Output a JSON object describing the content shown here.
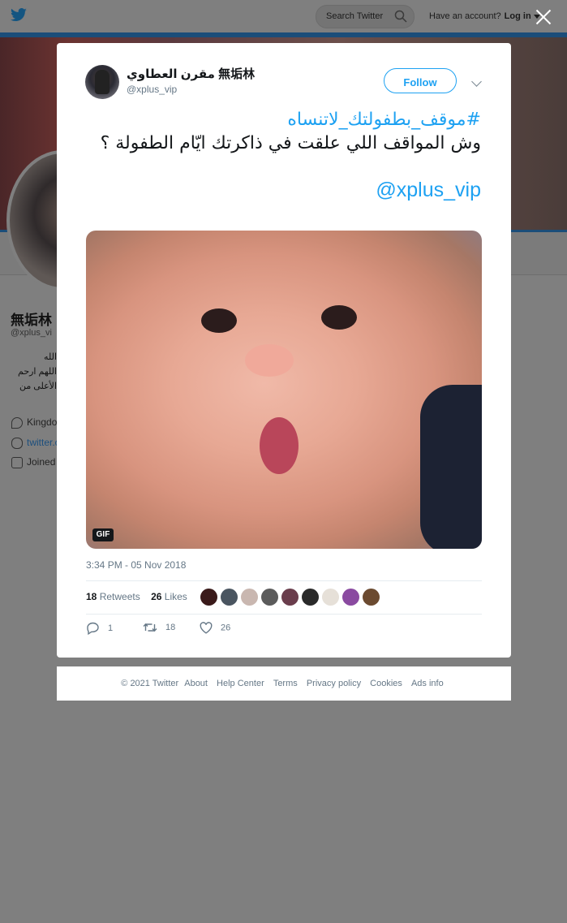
{
  "topbar": {
    "search_placeholder": "Search Twitter",
    "account_prompt": "Have an account?",
    "login_label": "Log in"
  },
  "background_profile": {
    "name": "無垢林",
    "handle": "@xplus_vi",
    "bio_lines": [
      "الله",
      "اللهم ارحم",
      "الأعلى من"
    ],
    "location": "Kingdo",
    "link": "twitter.c",
    "joined": "Joined"
  },
  "tweet": {
    "author_name": "مقرن العطاوي 無垢林",
    "author_handle": "@xplus_vip",
    "follow_label": "Follow",
    "hashtag": "#موقف_بطفولتك_لاتنساه",
    "text": "وش المواقف اللي علقت في ذاكرتك ايّام الطفولة ؟",
    "mention": "@xplus_vip",
    "media_badge": "GIF",
    "timestamp": "3:34 PM - 05 Nov 2018",
    "retweets_count": "18",
    "retweets_label": "Retweets",
    "likes_count": "26",
    "likes_label": "Likes",
    "liker_avatar_colors": [
      "#3a1a1a",
      "#4a5560",
      "#c9b7b0",
      "#5b5b5b",
      "#6a3d4c",
      "#2a2a2a",
      "#e6e0d8",
      "#8a4aa0",
      "#6b4a30"
    ],
    "reply_count": "1",
    "retweet_action_count": "18",
    "like_action_count": "26"
  },
  "footer": {
    "copyright": "© 2021 Twitter",
    "links": [
      "About",
      "Help Center",
      "Terms",
      "Privacy policy",
      "Cookies",
      "Ads info"
    ]
  },
  "colors": {
    "accent": "#1da1f2",
    "overlay": "#7f7f7f"
  }
}
